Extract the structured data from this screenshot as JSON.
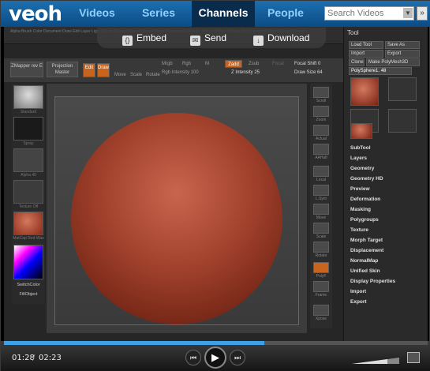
{
  "site": {
    "logo": "veoh",
    "nav": [
      {
        "label": "Videos",
        "active": false
      },
      {
        "label": "Series",
        "active": false
      },
      {
        "label": "Channels",
        "active": true
      },
      {
        "label": "People",
        "active": false
      }
    ],
    "search_placeholder": "Search Videos",
    "search_go_icon": "search-go-icon"
  },
  "overlay": {
    "embed": "Embed",
    "send": "Send",
    "download": "Download"
  },
  "zbrush": {
    "menu_text": "Alpha Brush Color Document Draw Edit Layer Light Macro Marker Material Movie Picker Preferences Render Stencil Stroke Texture Tool Transform Zoom Zplugin Zscript",
    "left_items": [
      "ZMapper rev E",
      "Projection Master"
    ],
    "toolbar": {
      "edit": "Edit",
      "draw": "Draw",
      "move": "Move",
      "scale": "Scale",
      "rotate": "Rotate",
      "mrgb": "Mrgb",
      "rgb": "Rgb",
      "m": "M",
      "rgb_intensity": "Rgb Intensity 100",
      "zadd": "Zadd",
      "zsub": "Zsub",
      "focal": "Focal",
      "z_intensity": "Z Intensity 25",
      "focal_shift": "Focal Shift 0",
      "draw_size": "Draw Size 64"
    },
    "left_labels": [
      "Standard",
      "Spray",
      "Alpha 40",
      "Texture Off",
      "MatCap Red Wax",
      "SwitchColor",
      "FillObject"
    ],
    "right_labels": [
      "Scroll",
      "Zoom",
      "Actual",
      "AAHalf",
      "Local",
      "L.Sym",
      "Move",
      "Scale",
      "Rotate",
      "PolyF",
      "Frame",
      "Xpose"
    ],
    "tool_panel": {
      "title": "Tool",
      "buttons": [
        "Load Tool",
        "Save As",
        "Import",
        "Export",
        "Clone",
        "Make PolyMesh3D"
      ],
      "current_tool": "PolySphere1. 48",
      "thumbs": [
        "PolySphere1",
        "SimpleBrush",
        "ZSphere",
        "Sphere3D",
        "PolyMesh3D",
        "PolySphere1"
      ],
      "menu": [
        "SubTool",
        "Layers",
        "Geometry",
        "Geometry HD",
        "Preview",
        "Deformation",
        "Masking",
        "Polygroups",
        "Texture",
        "Morph Target",
        "Displacement",
        "NormalMap",
        "Unified Skin",
        "Display Properties",
        "Import",
        "Export"
      ]
    }
  },
  "player": {
    "current_time": "01:28",
    "duration": "02:23",
    "progress": 0.615
  },
  "colors": {
    "brand_blue": "#1d6fb0",
    "sphere_red": "#a1412c",
    "progress_blue": "#3ea0e8"
  }
}
